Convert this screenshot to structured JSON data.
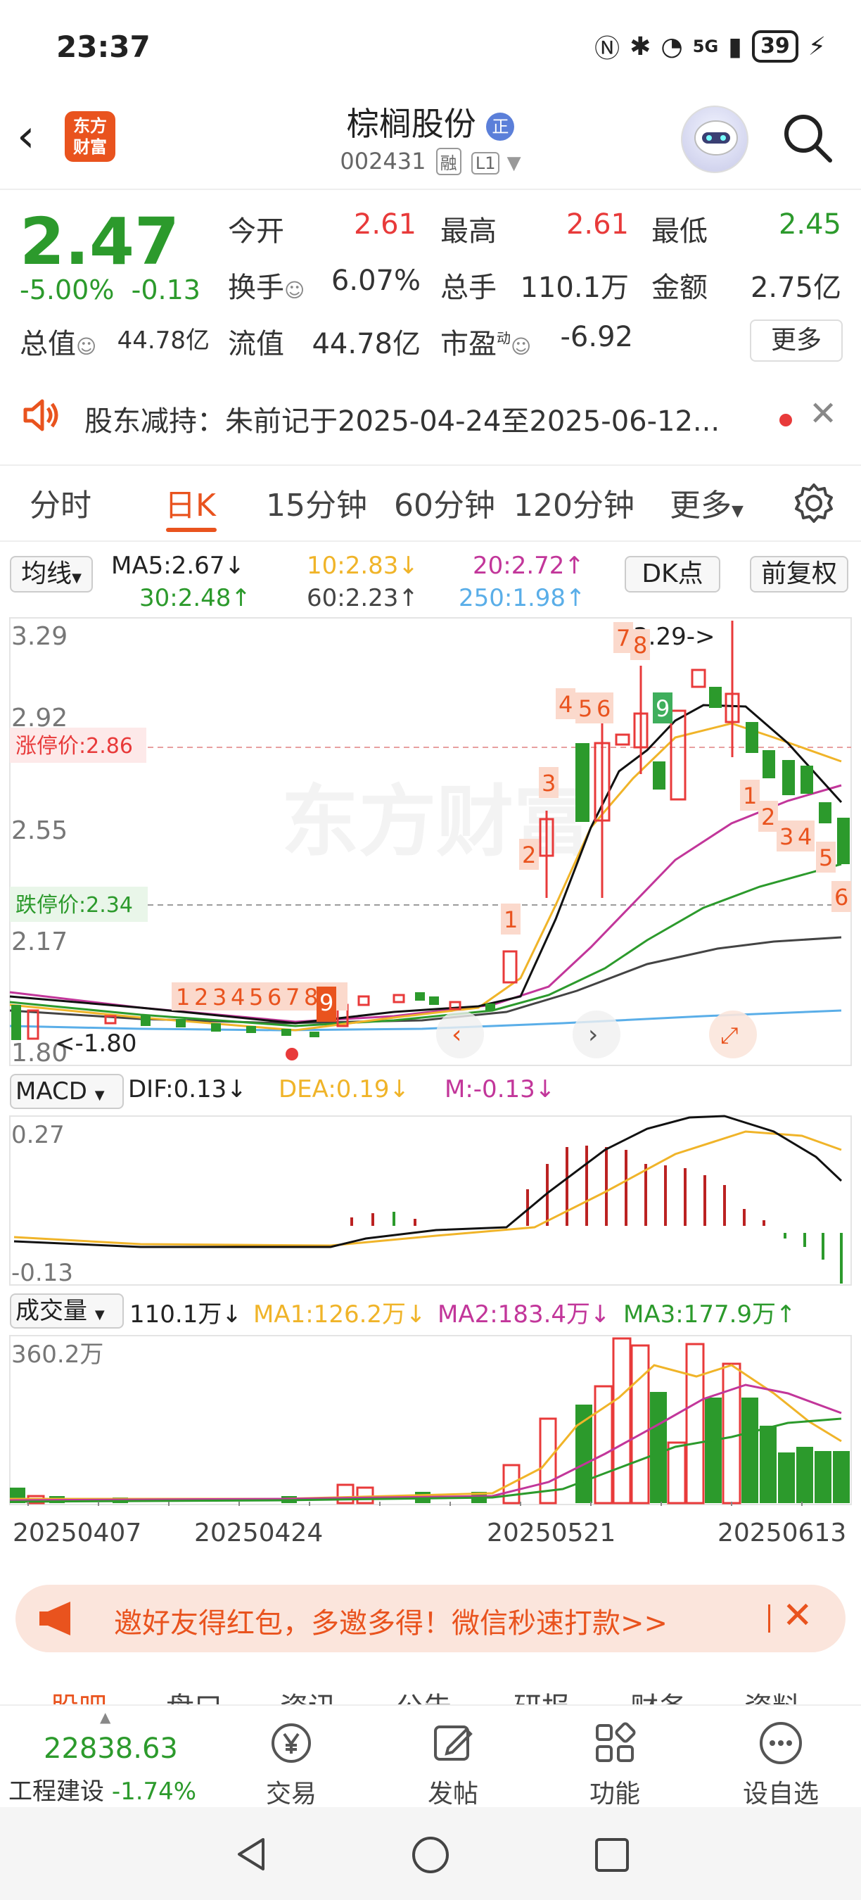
{
  "status_bar": {
    "time": "23:37",
    "network": "5G",
    "battery": "39"
  },
  "header": {
    "logo_text": "东方\n财富",
    "stock_name": "棕榈股份",
    "verified_badge": "正",
    "stock_code": "002431",
    "tag_margin": "融",
    "tag_level": "L1"
  },
  "quote": {
    "price": "2.47",
    "change_pct": "-5.00%",
    "change": "-0.13",
    "fields": [
      {
        "label": "今开",
        "value": "2.61",
        "color": "red"
      },
      {
        "label": "最高",
        "value": "2.61",
        "color": "red"
      },
      {
        "label": "最低",
        "value": "2.45",
        "color": "green"
      },
      {
        "label": "换手",
        "value": "6.07%",
        "color": "black"
      },
      {
        "label": "总手",
        "value": "110.1万",
        "color": "black"
      },
      {
        "label": "金额",
        "value": "2.75亿",
        "color": "black"
      },
      {
        "label": "总值",
        "value": "44.78亿",
        "color": "black"
      },
      {
        "label": "流值",
        "value": "44.78亿",
        "color": "black"
      },
      {
        "label": "市盈",
        "value": "-6.92",
        "color": "black"
      }
    ],
    "pe_superscript": "动",
    "more_label": "更多"
  },
  "notice": {
    "text": "股东减持：朱前记于2025-04-24至2025-06-12..."
  },
  "tabs": [
    "分时",
    "日K",
    "15分钟",
    "60分钟",
    "120分钟",
    "更多"
  ],
  "active_tab": "日K",
  "ma_legend": {
    "selector": "均线",
    "items": [
      {
        "text": "MA5:2.67↓",
        "color": "#222222"
      },
      {
        "text": "10:2.83↓",
        "color": "#f0b429"
      },
      {
        "text": "20:2.72↑",
        "color": "#c2369a"
      },
      {
        "text": "30:2.48↑",
        "color": "#2c9a2c"
      },
      {
        "text": "60:2.23↑",
        "color": "#444444"
      },
      {
        "text": "250:1.98↑",
        "color": "#5aaee8"
      }
    ],
    "dk_label": "DK点",
    "adjust_label": "前复权"
  },
  "kline": {
    "y_ticks": [
      "3.29",
      "2.92",
      "2.55",
      "2.17",
      "1.80"
    ],
    "limit_up": "涨停价:2.86",
    "limit_down": "跌停价:2.34",
    "high_marker": "3.29->",
    "low_marker": "<-1.80",
    "watermark": "东方财富",
    "nine_turn_labels": [
      "1",
      "2",
      "3",
      "4",
      "5",
      "6",
      "7",
      "8",
      "9"
    ],
    "down_labels": [
      "1",
      "2",
      "3",
      "4",
      "5",
      "6"
    ]
  },
  "macd": {
    "selector": "MACD",
    "dif": "DIF:0.13↓",
    "dea": "DEA:0.19↓",
    "m": "M:-0.13↓",
    "y_top": "0.27",
    "y_bottom": "-0.13"
  },
  "volume": {
    "selector": "成交量",
    "value": "110.1万↓",
    "ma1": "MA1:126.2万↓",
    "ma2": "MA2:183.4万↓",
    "ma3": "MA3:177.9万↑",
    "y_top": "360.2万"
  },
  "dates": [
    "20250407",
    "20250424",
    "20250521",
    "20250613"
  ],
  "banner": {
    "text": "邀好友得红包，多邀多得！微信秒速打款>>"
  },
  "sub_tabs": [
    "股吧",
    "盘口",
    "资讯",
    "公告",
    "研报",
    "财务",
    "资料"
  ],
  "bottom_bar": {
    "index_value": "22838.63",
    "index_name": "工程建设",
    "index_change": "-1.74%",
    "items": [
      "交易",
      "发帖",
      "功能",
      "设自选"
    ]
  },
  "colors": {
    "up": "#e83a3a",
    "down": "#2c9a2c",
    "accent": "#e9531e"
  }
}
